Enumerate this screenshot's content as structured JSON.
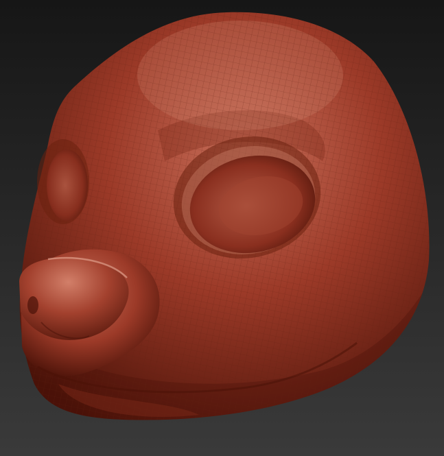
{
  "viewport": {
    "background_top": "#161616",
    "background_bottom": "#3a3a3a"
  },
  "model": {
    "material_base": "#9c3a28",
    "material_light": "#c9705b",
    "material_shadow": "#4a1208",
    "wireframe_color": "#5e1e12"
  }
}
